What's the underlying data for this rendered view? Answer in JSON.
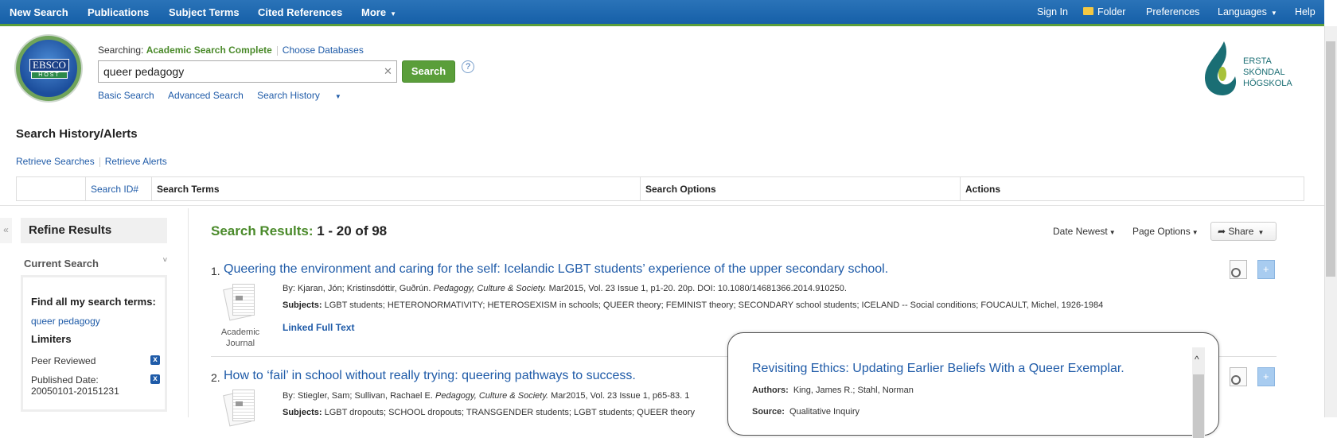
{
  "nav": {
    "left": [
      "New Search",
      "Publications",
      "Subject Terms",
      "Cited References",
      "More"
    ],
    "right": [
      "Sign In",
      "Folder",
      "Preferences",
      "Languages",
      "Help"
    ]
  },
  "logo": {
    "text": "EBSCO",
    "sub": "HOST"
  },
  "search": {
    "searching_label": "Searching:",
    "database": "Academic Search Complete",
    "choose": "Choose Databases",
    "query": "queer pedagogy",
    "button": "Search",
    "help": "?",
    "links": [
      "Basic Search",
      "Advanced Search",
      "Search History"
    ]
  },
  "institution": {
    "lines": [
      "ERSTA",
      "SKÖNDAL",
      "HÖGSKOLA"
    ],
    "colors": {
      "teal": "#1a6e74",
      "green": "#a8c23a"
    }
  },
  "history": {
    "title": "Search History/Alerts",
    "retrieve_searches": "Retrieve Searches",
    "retrieve_alerts": "Retrieve Alerts",
    "columns": [
      "",
      "Search ID#",
      "Search Terms",
      "Search Options",
      "Actions"
    ]
  },
  "sidebar": {
    "collapse": "«",
    "refine": "Refine Results",
    "current_search": "Current Search",
    "find_all": "Find all my search terms:",
    "query": "queer pedagogy",
    "limiters": "Limiters",
    "limits": [
      {
        "label": "Peer Reviewed"
      },
      {
        "label": "Published Date:",
        "value": "20050101-20151231"
      }
    ],
    "remove": "x"
  },
  "results": {
    "label": "Search Results:",
    "range": "1 - 20 of 98",
    "sort": "Date Newest",
    "page_options": "Page Options",
    "share": "Share",
    "items": [
      {
        "num": "1.",
        "title": "Queering the environment and caring for the self: Icelandic LGBT students’ experience of the upper secondary school.",
        "by": "By: Kjaran, Jón; Kristinsdóttir, Guðrún.",
        "journal": "Pedagogy, Culture & Society.",
        "details": "Mar2015, Vol. 23 Issue 1, p1-20. 20p. DOI: 10.1080/14681366.2014.910250.",
        "subjects_label": "Subjects:",
        "subjects": "LGBT students; HETERONORMATIVITY; HETEROSEXISM in schools; QUEER theory; FEMINIST theory; SECONDARY school students; ICELAND -- Social conditions; FOUCAULT, Michel, 1926-1984",
        "type": "Academic Journal",
        "full_text": "Linked Full Text"
      },
      {
        "num": "2.",
        "title": "How to ‘fail’ in school without really trying: queering pathways to success.",
        "by": "By: Stiegler, Sam; Sullivan, Rachael E.",
        "journal": "Pedagogy, Culture & Society.",
        "details": "Mar2015, Vol. 23 Issue 1, p65-83. 1",
        "subjects_label": "Subjects:",
        "subjects": "LGBT dropouts; SCHOOL dropouts; TRANSGENDER students; LGBT students; QUEER theory"
      }
    ]
  },
  "popup": {
    "title": "Revisiting Ethics: Updating Earlier Beliefs With a Queer Exemplar.",
    "authors_label": "Authors:",
    "authors": "King, James R.; Stahl, Norman",
    "source_label": "Source:",
    "source": "Qualitative Inquiry"
  },
  "colors": {
    "nav": "#1f68b0",
    "accent_green": "#5a9e3a",
    "link": "#1f5ba8"
  }
}
